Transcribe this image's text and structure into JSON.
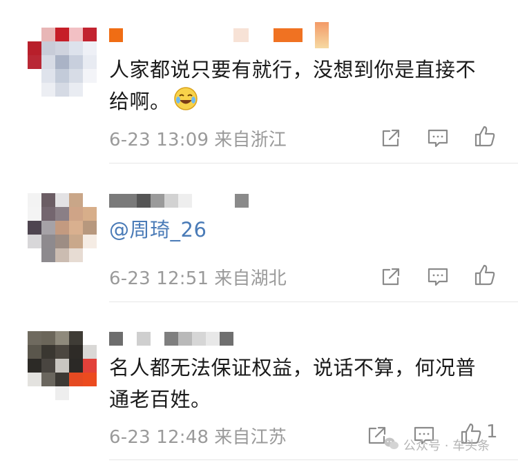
{
  "comments": [
    {
      "text": "人家都说只要有就行，没想到你是直接不给啊。",
      "emoji": "laughing-crying-emoji",
      "date": "6-23 13:09",
      "location": "来自浙江"
    },
    {
      "mention": "@周琦_26",
      "date": "6-23 12:51",
      "location": "来自湖北"
    },
    {
      "text": "名人都无法保证权益，说话不算，何况普通老百姓。",
      "date": "6-23 12:48",
      "location": "来自江苏",
      "like_count": "1"
    }
  ],
  "actions": {
    "icons": [
      "share-icon",
      "reply-icon",
      "like-icon"
    ],
    "color": "#8a8a8a"
  },
  "watermark": {
    "text": "公众号 · 车头条"
  },
  "colors": {
    "mention": "#4a7bb7",
    "meta": "#9a9a9a",
    "divider": "#e6e6e6"
  }
}
